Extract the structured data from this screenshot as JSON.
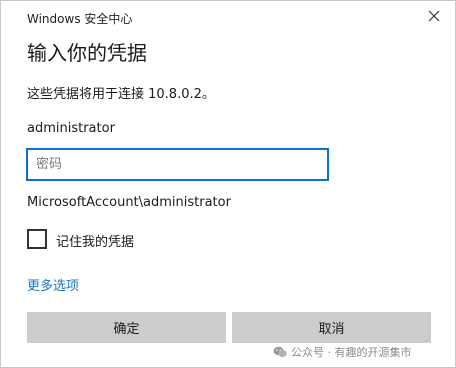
{
  "window": {
    "title": "Windows 安全中心"
  },
  "dialog": {
    "heading": "输入你的凭据",
    "description": "这些凭据将用于连接 10.8.0.2。",
    "username": "administrator",
    "password_placeholder": "密码",
    "password_value": "",
    "account_full": "MicrosoftAccount\\administrator",
    "remember_label": "记住我的凭据",
    "remember_checked": false,
    "more_options": "更多选项",
    "ok_label": "确定",
    "cancel_label": "取消"
  },
  "watermark": {
    "text": "公众号 · 有趣的开源集市"
  },
  "colors": {
    "accent": "#0a70d4",
    "link": "#1a73c8",
    "button_bg": "#cccccc"
  },
  "icons": {
    "close": "close-icon",
    "watermark": "wechat-icon"
  }
}
